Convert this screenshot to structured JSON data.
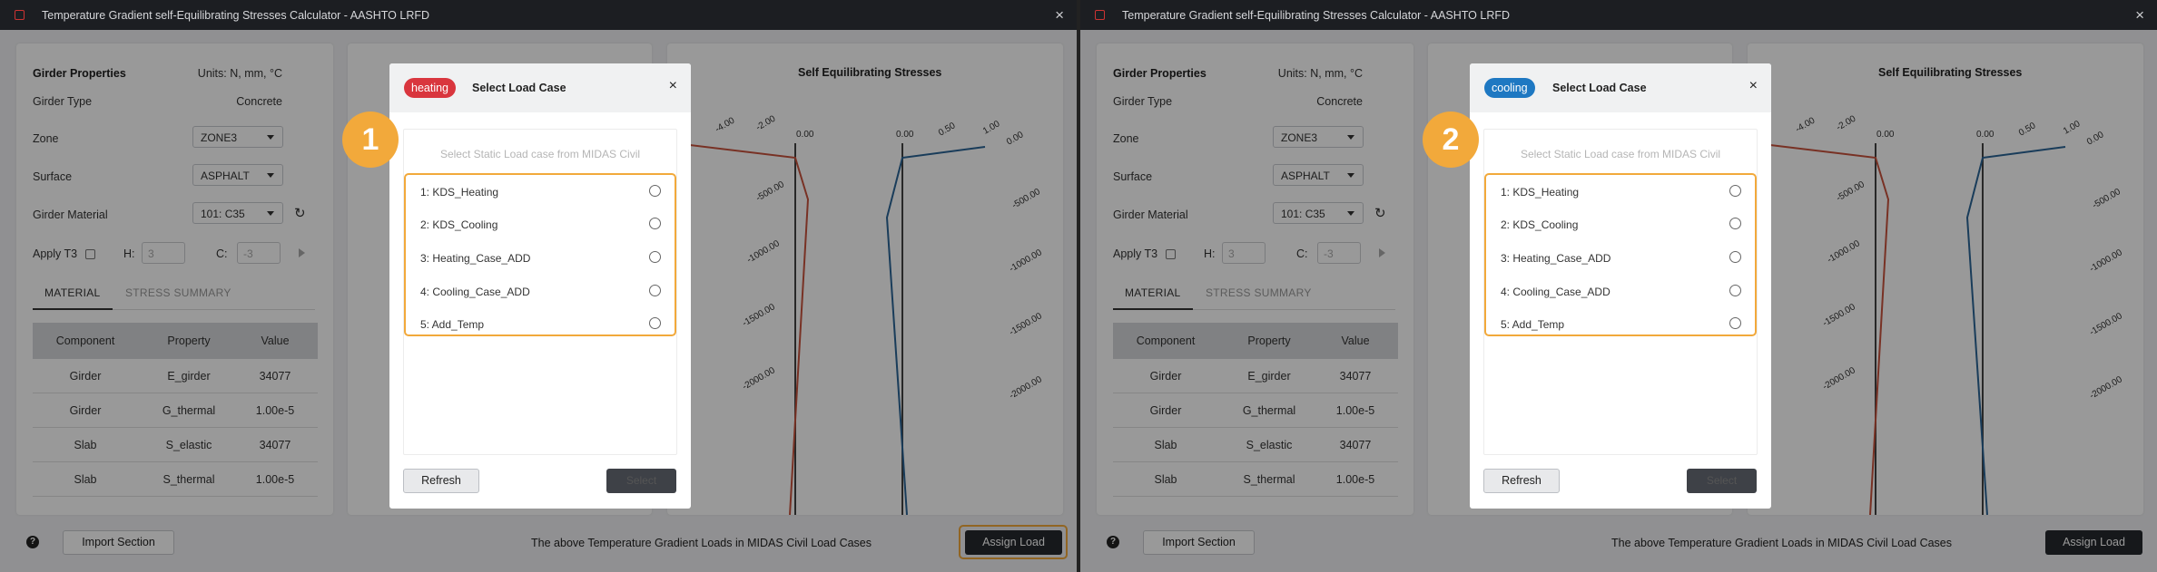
{
  "window": {
    "title": "Temperature Gradient self-Equilibrating Stresses Calculator - AASHTO LRFD",
    "close": "×"
  },
  "props": {
    "heading": "Girder Properties",
    "units": "Units: N, mm, °C",
    "girder_type_label": "Girder Type",
    "girder_type_value": "Concrete",
    "zone_label": "Zone",
    "zone_value": "ZONE3",
    "surface_label": "Surface",
    "surface_value": "ASPHALT",
    "material_label": "Girder Material",
    "material_value": "101: C35",
    "apply_t3_label": "Apply T3",
    "h_label": "H:",
    "h_placeholder": "3",
    "c_label": "C:",
    "c_placeholder": "-3"
  },
  "tabs": {
    "material": "MATERIAL",
    "summary": "STRESS SUMMARY"
  },
  "table": {
    "headers": [
      "Component",
      "Property",
      "Value"
    ],
    "rows": [
      [
        "Girder",
        "E_girder",
        "34077"
      ],
      [
        "Girder",
        "G_thermal",
        "1.00e-5"
      ],
      [
        "Slab",
        "S_elastic",
        "34077"
      ],
      [
        "Slab",
        "S_thermal",
        "1.00e-5"
      ]
    ]
  },
  "charts": {
    "title": "Self Equilibrating Stresses",
    "colors": {
      "heating": "#c9533d",
      "cooling": "#2a6496",
      "axis": "#444444"
    },
    "left_x_ticks": [
      "-4.00",
      "-2.00",
      "0.00"
    ],
    "right_x_ticks": [
      "0.00",
      "0.50",
      "1.00"
    ],
    "y_ticks": [
      "0.00",
      "-500.00",
      "-1000.00",
      "-1500.00",
      "-2000.00"
    ]
  },
  "bottom": {
    "help": "?",
    "import": "Import Section",
    "message": "The above Temperature Gradient Loads in MIDAS Civil Load Cases",
    "assign": "Assign Load"
  },
  "modal": {
    "title": "Select Load Case",
    "close": "×",
    "hint": "Select Static Load case from MIDAS Civil",
    "items": [
      "1: KDS_Heating",
      "2: KDS_Cooling",
      "3: Heating_Case_ADD",
      "4: Cooling_Case_ADD",
      "5: Add_Temp"
    ],
    "refresh": "Refresh",
    "select": "Select"
  },
  "panels": {
    "left": {
      "step": "1",
      "pill": "heating",
      "pill_color": "#d9363e"
    },
    "right": {
      "step": "2",
      "pill": "cooling",
      "pill_color": "#1e78c2"
    }
  }
}
